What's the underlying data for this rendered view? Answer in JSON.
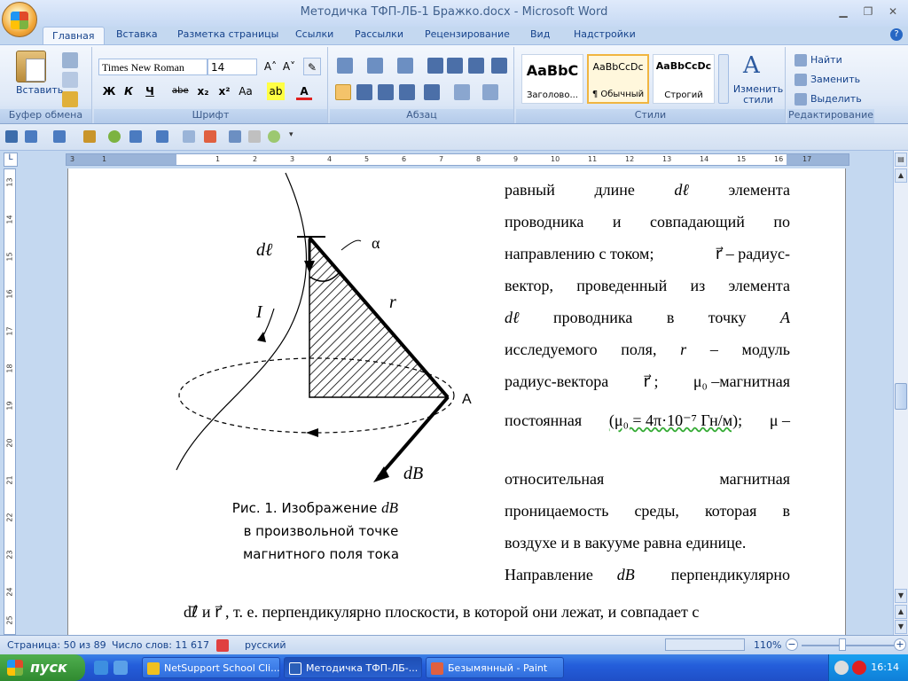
{
  "window": {
    "title": "Методичка ТФП-ЛБ-1 Бражко.docx - Microsoft Word"
  },
  "tabs": [
    "Главная",
    "Вставка",
    "Разметка страницы",
    "Ссылки",
    "Рассылки",
    "Рецензирование",
    "Вид",
    "Надстройки"
  ],
  "ribbon": {
    "clipboard": {
      "paste_label": "Вставить",
      "group": "Буфер обмена"
    },
    "font": {
      "name": "Times New Roman",
      "size": "14",
      "group": "Шрифт",
      "bold": "Ж",
      "italic": "К",
      "underline": "Ч",
      "strike": "abe",
      "sub": "x₂",
      "sup": "x²",
      "case": "Aa"
    },
    "paragraph": {
      "group": "Абзац"
    },
    "styles": {
      "group": "Стили",
      "items": [
        {
          "preview": "AaBbC",
          "name": "Заголово..."
        },
        {
          "preview": "AaBbCcDc",
          "name": "¶ Обычный"
        },
        {
          "preview": "AaBbCcDc",
          "name": "Строгий"
        }
      ],
      "change_label": "Изменить стили"
    },
    "editing": {
      "group": "Редактирование",
      "find": "Найти",
      "replace": "Заменить",
      "select": "Выделить"
    }
  },
  "ruler": {
    "ticks": [
      "3",
      "1",
      "1",
      "2",
      "3",
      "4",
      "5",
      "6",
      "7",
      "8",
      "9",
      "10",
      "11",
      "12",
      "13",
      "14",
      "15",
      "16",
      "17"
    ]
  },
  "vruler": {
    "ticks": [
      "13",
      "14",
      "15",
      "16",
      "17",
      "18",
      "19",
      "20",
      "21",
      "22",
      "23",
      "24",
      "25"
    ]
  },
  "document": {
    "figure": {
      "label_dl": "dℓ",
      "label_alpha": "α",
      "label_r": "r",
      "label_I": "I",
      "label_A": "A",
      "label_dB": "dB⃗"
    },
    "caption": {
      "line1": "Рис. 1. Изображение",
      "dB": "dB⃗",
      "line2": "в произвольной точке",
      "line3": "магнитного поля тока"
    },
    "right_lines": [
      [
        "равный",
        "длине",
        "dℓ",
        "элемента"
      ],
      [
        "проводника",
        "и",
        "совпадающий",
        "по"
      ],
      [
        "направлению с током;",
        "r⃗ – радиус-"
      ],
      [
        "вектор,",
        "проведенный",
        "из",
        "элемента"
      ],
      [
        "dℓ",
        "проводника",
        "в",
        "точку",
        "A"
      ],
      [
        "исследуемого",
        "поля,",
        "r",
        "–",
        "модуль"
      ],
      [
        "радиус-вектора",
        "r⃗ ;",
        "μ₀ –магнитная"
      ],
      [
        "постоянная",
        "(μ₀ = 4π·10⁻⁷ Гн/м);",
        "μ –"
      ],
      [
        "относительная",
        "магнитная"
      ],
      [
        "проницаемость",
        "среды,",
        "которая",
        "в"
      ],
      [
        "воздухе и в вакууме равна единице."
      ],
      [
        "Направление",
        "dB⃗",
        "перпендикулярно"
      ]
    ],
    "full_line": "dℓ⃗  и  r⃗ , т. е. перпендикулярно плоскости, в которой они лежат, и совпадает с"
  },
  "status": {
    "page": "Страница: 50 из 89",
    "words": "Число слов: 11 617",
    "lang": "русский",
    "zoom": "110%"
  },
  "taskbar": {
    "start": "пуск",
    "tasks": [
      "NetSupport School Cli...",
      "Методичка ТФП-ЛБ-...",
      "Безымянный - Paint"
    ],
    "time": "16:14"
  }
}
